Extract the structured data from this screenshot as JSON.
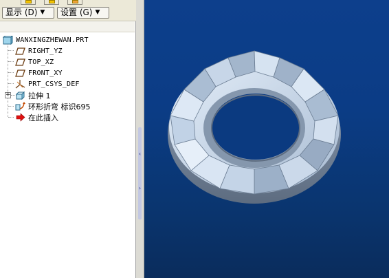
{
  "toolbar": {
    "show_label": "显示 (D)",
    "settings_label": "设置 (G)"
  },
  "tree": {
    "root": "WANXINGZHEWAN.PRT",
    "items": [
      {
        "label": "RIGHT_YZ",
        "icon": "datum-plane-icon"
      },
      {
        "label": "TOP_XZ",
        "icon": "datum-plane-icon"
      },
      {
        "label": "FRONT_XY",
        "icon": "datum-plane-icon"
      },
      {
        "label": "PRT_CSYS_DEF",
        "icon": "coordinate-system-icon"
      },
      {
        "label": "拉伸 1",
        "icon": "extrude-feature-icon"
      },
      {
        "label": "环形折弯 标识695",
        "icon": "toroidal-bend-icon"
      },
      {
        "label": "在此插入",
        "icon": "insert-here-arrow-icon"
      }
    ]
  },
  "colors": {
    "viewport_top": "#0d3f8c",
    "viewport_bottom": "#0a2c5c",
    "model_light": "#d8e6f6",
    "model_mid": "#9aaec6",
    "model_dark": "#6c7e96"
  }
}
